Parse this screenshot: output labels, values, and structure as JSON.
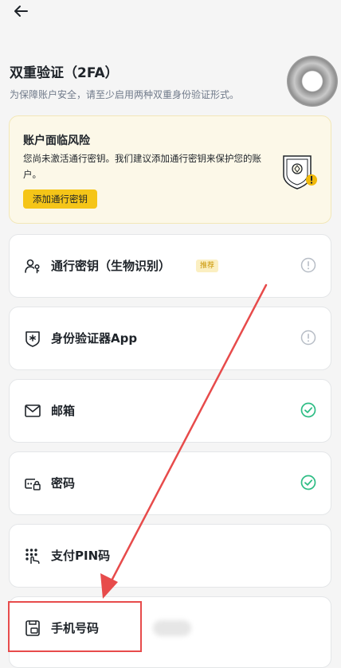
{
  "header": {
    "back_icon": "arrow-left-icon"
  },
  "page": {
    "title": "双重验证（2FA）",
    "subtitle": "为保障账户安全，请至少启用两种双重身份验证形式。"
  },
  "risk_banner": {
    "title": "账户面临风险",
    "description": "您尚未激活通行密钥。我们建议添加通行密钥来保护您的账户。",
    "button_label": "添加通行密钥",
    "illustration_icon": "shield-warning-icon"
  },
  "methods": [
    {
      "label": "通行密钥（生物识别）",
      "badge": "推荐",
      "icon": "passkey-icon",
      "status": "not-enabled"
    },
    {
      "label": "身份验证器App",
      "icon": "authenticator-icon",
      "status": "not-enabled"
    },
    {
      "label": "邮箱",
      "icon": "mail-icon",
      "status": "enabled"
    },
    {
      "label": "密码",
      "icon": "password-icon",
      "status": "enabled"
    },
    {
      "label": "支付PIN码",
      "icon": "pin-icon",
      "status": "none"
    },
    {
      "label": "手机号码",
      "icon": "phone-icon",
      "status": "none"
    }
  ],
  "colors": {
    "accent": "#f5c518",
    "success": "#2ebd85",
    "annotation": "#e74b4b",
    "banner_bg": "#fcf8e8"
  }
}
